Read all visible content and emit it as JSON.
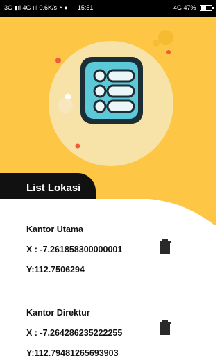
{
  "status": {
    "network_left": "3G ▮ıl 4G ııl 0.6K/s",
    "time": "15:51",
    "right_indicators": "4G 47%",
    "battery_percent": 47
  },
  "header": {
    "title": "List Lokasi"
  },
  "locations": [
    {
      "name": "Kantor Utama",
      "x": "X : -7.261858300000001",
      "y": "Y:112.7506294"
    },
    {
      "name": "Kantor Direktur",
      "x": "X : -7.264286235222255",
      "y": "Y:112.79481265693903"
    }
  ],
  "icons": {
    "hero": "list-icon",
    "delete": "trash-icon"
  },
  "colors": {
    "primary": "#FDC644",
    "dark": "#111111",
    "accent": "#F15A3C",
    "icon_teal": "#5BC9D8"
  }
}
